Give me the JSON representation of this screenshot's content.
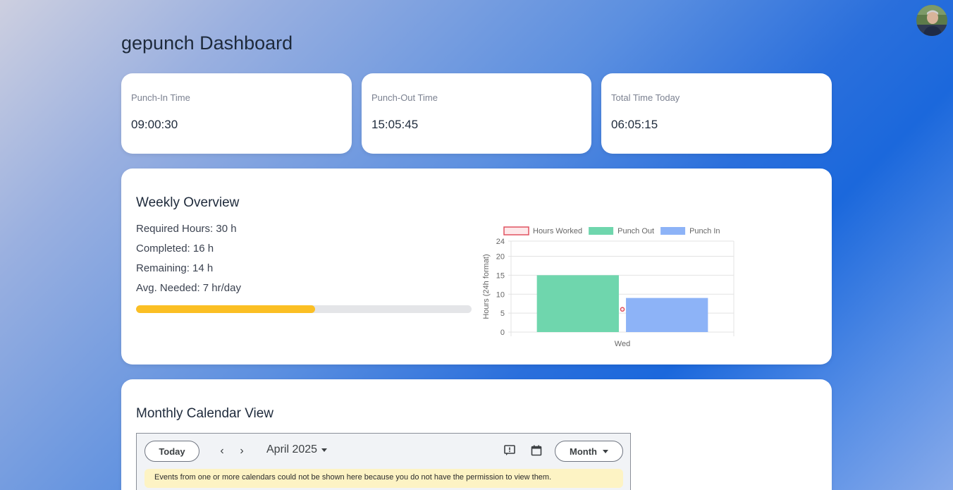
{
  "page": {
    "title": "gepunch Dashboard"
  },
  "stats": [
    {
      "label": "Punch-In Time",
      "value": "09:00:30"
    },
    {
      "label": "Punch-Out Time",
      "value": "15:05:45"
    },
    {
      "label": "Total Time Today",
      "value": "06:05:15"
    }
  ],
  "weekly": {
    "title": "Weekly Overview",
    "required": "Required Hours: 30 h",
    "completed": "Completed: 16 h",
    "remaining": "Remaining: 14 h",
    "avg": "Avg. Needed: 7 hr/day",
    "progress_fraction": 0.533
  },
  "chart_data": {
    "type": "bar",
    "categories": [
      "Wed"
    ],
    "series": [
      {
        "name": "Hours Worked",
        "kind": "line",
        "values": [
          6
        ],
        "color": "#e05260"
      },
      {
        "name": "Punch Out",
        "kind": "bar",
        "values": [
          15
        ],
        "color": "#6fd6ad"
      },
      {
        "name": "Punch In",
        "kind": "bar",
        "values": [
          9
        ],
        "color": "#8db3f7"
      }
    ],
    "ylabel": "Hours (24h format)",
    "xlabel": "",
    "ylim": [
      0,
      24
    ],
    "yticks": [
      "0",
      "5",
      "10",
      "15",
      "20",
      "24"
    ],
    "grid": true,
    "legend": "top"
  },
  "calendar": {
    "title": "Monthly Calendar View",
    "today_label": "Today",
    "month_label": "April 2025",
    "view_label": "Month",
    "notice": "Events from one or more calendars could not be shown here because you do not have the permission to view them."
  },
  "colors": {
    "accent": "#fbbf24",
    "text": "#1e2a3b"
  }
}
